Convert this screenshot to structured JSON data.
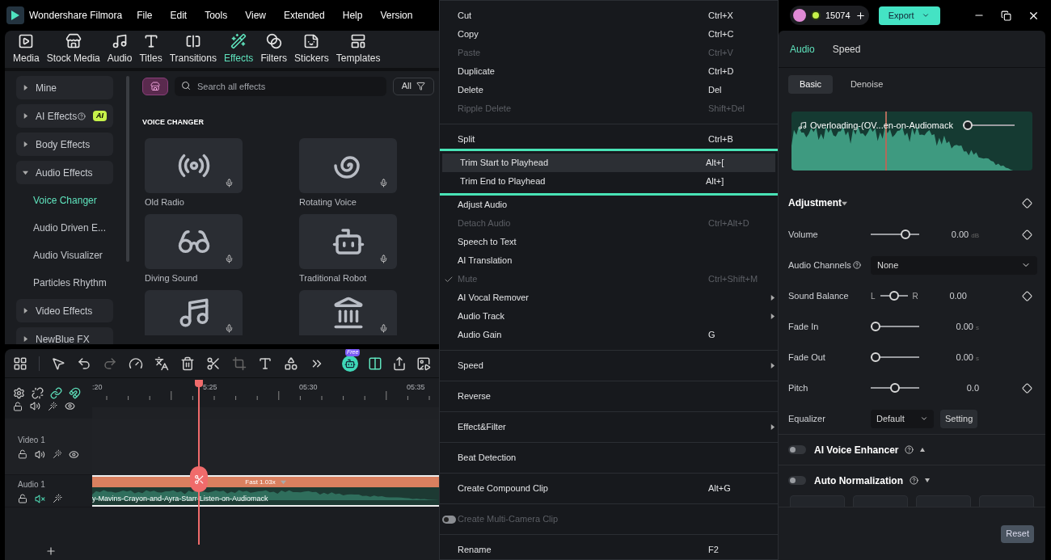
{
  "app": {
    "title": "Wondershare Filmora"
  },
  "menu_bar": [
    "File",
    "Edit",
    "Tools",
    "View",
    "Extended",
    "Help",
    "Version"
  ],
  "media_tabs": [
    {
      "label": "Media",
      "selected": false
    },
    {
      "label": "Stock Media",
      "selected": false
    },
    {
      "label": "Audio",
      "selected": false
    },
    {
      "label": "Titles",
      "selected": false
    },
    {
      "label": "Transitions",
      "selected": false
    },
    {
      "label": "Effects",
      "selected": true
    },
    {
      "label": "Filters",
      "selected": false
    },
    {
      "label": "Stickers",
      "selected": false
    },
    {
      "label": "Templates",
      "selected": false
    }
  ],
  "sidebar": {
    "items": [
      {
        "label": "Mine",
        "expanded": false
      },
      {
        "label": "AI Effects",
        "help": true,
        "badge": "AI",
        "expanded": false
      },
      {
        "label": "Body Effects",
        "expanded": false
      },
      {
        "label": "Audio Effects",
        "expanded": true,
        "children": [
          {
            "label": "Voice Changer",
            "selected": true
          },
          {
            "label": "Audio Driven E...",
            "selected": false
          },
          {
            "label": "Audio Visualizer",
            "selected": false
          },
          {
            "label": "Particles Rhythm",
            "selected": false
          }
        ]
      },
      {
        "label": "Video Effects",
        "expanded": false
      },
      {
        "label": "NewBlue FX",
        "expanded": false
      }
    ]
  },
  "effects": {
    "search": {
      "placeholder": "Search all effects"
    },
    "filter": "All",
    "section": "VOICE CHANGER",
    "items": [
      {
        "kind": "tile",
        "name": "Old Radio"
      },
      {
        "kind": "tile",
        "name": "Rotating Voice"
      },
      {
        "kind": "tile",
        "name": "Diving Sound"
      },
      {
        "kind": "tile",
        "name": "Traditional Robot"
      },
      {
        "kind": "partial"
      },
      {
        "kind": "partial"
      }
    ]
  },
  "timeline": {
    "free_badge": "Free",
    "ruler": [
      ":20",
      "5:25",
      "05:30",
      "05:35"
    ],
    "tracks": [
      {
        "kind": "partial",
        "muted": false
      },
      {
        "kind": "video",
        "name": "Video 1",
        "muted": false
      },
      {
        "kind": "audio",
        "name": "Audio 1",
        "muted": true
      }
    ],
    "clip": {
      "speed": "Fast 1.03x",
      "name": "y-Mavins-Crayon-and-Ayra-Starr-Listen-on-Audiomack"
    }
  },
  "context_menu": {
    "sections": [
      {
        "divider": false,
        "outlined": false,
        "items": [
          {
            "kind": "plain",
            "label": "Cut",
            "shortcut": "Ctrl+X",
            "disabled": false,
            "checked": false,
            "submenu": false,
            "hovered": false
          },
          {
            "kind": "plain",
            "label": "Copy",
            "shortcut": "Ctrl+C",
            "disabled": false,
            "checked": false,
            "submenu": false,
            "hovered": false
          },
          {
            "kind": "plain",
            "label": "Paste",
            "shortcut": "Ctrl+V",
            "disabled": true,
            "checked": false,
            "submenu": false,
            "hovered": false
          },
          {
            "kind": "plain",
            "label": "Duplicate",
            "shortcut": "Ctrl+D",
            "disabled": false,
            "checked": false,
            "submenu": false,
            "hovered": false
          },
          {
            "kind": "plain",
            "label": "Delete",
            "shortcut": "Del",
            "disabled": false,
            "checked": false,
            "submenu": false,
            "hovered": false
          },
          {
            "kind": "plain",
            "label": "Ripple Delete",
            "shortcut": "Shift+Del",
            "disabled": true,
            "checked": false,
            "submenu": false,
            "hovered": false
          }
        ]
      },
      {
        "divider": true,
        "outlined": false,
        "items": [
          {
            "kind": "plain",
            "label": "Split",
            "shortcut": "Ctrl+B",
            "disabled": false,
            "checked": false,
            "submenu": false,
            "hovered": false
          }
        ]
      },
      {
        "divider": false,
        "outlined": true,
        "items": [
          {
            "kind": "plain",
            "label": "Trim Start to Playhead",
            "shortcut": "Alt+[",
            "disabled": false,
            "checked": false,
            "submenu": false,
            "hovered": true
          },
          {
            "kind": "plain",
            "label": "Trim End to Playhead",
            "shortcut": "Alt+]",
            "disabled": false,
            "checked": false,
            "submenu": false,
            "hovered": false
          }
        ]
      },
      {
        "divider": false,
        "outlined": false,
        "items": [
          {
            "kind": "plain",
            "label": "Adjust Audio",
            "disabled": false,
            "checked": false,
            "submenu": false,
            "hovered": false
          },
          {
            "kind": "plain",
            "label": "Detach Audio",
            "shortcut": "Ctrl+Alt+D",
            "disabled": true,
            "checked": false,
            "submenu": false,
            "hovered": false
          },
          {
            "kind": "plain",
            "label": "Speech to Text",
            "disabled": false,
            "checked": false,
            "submenu": false,
            "hovered": false
          },
          {
            "kind": "plain",
            "label": "AI Translation",
            "disabled": false,
            "checked": false,
            "submenu": false,
            "hovered": false
          },
          {
            "kind": "check",
            "label": "Mute",
            "shortcut": "Ctrl+Shift+M",
            "disabled": true,
            "checked": true,
            "submenu": false,
            "hovered": false
          },
          {
            "kind": "plain",
            "label": "AI Vocal Remover",
            "disabled": false,
            "checked": false,
            "submenu": true,
            "hovered": false
          },
          {
            "kind": "plain",
            "label": "Audio Track",
            "disabled": false,
            "checked": false,
            "submenu": true,
            "hovered": false
          },
          {
            "kind": "plain",
            "label": "Audio Gain",
            "shortcut": "G",
            "disabled": false,
            "checked": false,
            "submenu": false,
            "hovered": false
          }
        ]
      },
      {
        "divider": true,
        "outlined": false,
        "items": [
          {
            "kind": "plain",
            "label": "Speed",
            "disabled": false,
            "checked": false,
            "submenu": true,
            "hovered": false
          }
        ]
      },
      {
        "divider": true,
        "outlined": false,
        "items": [
          {
            "kind": "plain",
            "label": "Reverse",
            "disabled": false,
            "checked": false,
            "submenu": false,
            "hovered": false
          }
        ]
      },
      {
        "divider": true,
        "outlined": false,
        "items": [
          {
            "kind": "plain",
            "label": "Effect&Filter",
            "disabled": false,
            "checked": false,
            "submenu": true,
            "hovered": false
          }
        ]
      },
      {
        "divider": true,
        "outlined": false,
        "items": [
          {
            "kind": "plain",
            "label": "Beat Detection",
            "disabled": false,
            "checked": false,
            "submenu": false,
            "hovered": false
          }
        ]
      },
      {
        "divider": true,
        "outlined": false,
        "items": [
          {
            "kind": "plain",
            "label": "Create Compound Clip",
            "shortcut": "Alt+G",
            "disabled": false,
            "checked": false,
            "submenu": false,
            "hovered": false
          }
        ]
      },
      {
        "divider": true,
        "outlined": false,
        "items": [
          {
            "kind": "switch",
            "label": "Create Multi-Camera Clip",
            "disabled": true,
            "checked": false,
            "submenu": false,
            "hovered": false
          }
        ]
      },
      {
        "divider": true,
        "outlined": false,
        "items": [
          {
            "kind": "plain",
            "label": "Rename",
            "shortcut": "F2",
            "disabled": false,
            "checked": false,
            "submenu": false,
            "hovered": false
          }
        ]
      }
    ]
  },
  "account": {
    "credits": "15074",
    "export": "Export"
  },
  "properties": {
    "tabs": [
      {
        "label": "Audio",
        "selected": true
      },
      {
        "label": "Speed",
        "selected": false
      }
    ],
    "subtabs": [
      {
        "label": "Basic",
        "selected": true
      },
      {
        "label": "Denoise",
        "selected": false
      }
    ],
    "clip": {
      "name": "Overloading-(OV...en-on-Audiomack",
      "level": 0
    },
    "section": "Adjustment",
    "rows": [
      {
        "kind": "slider",
        "label": "Volume",
        "level": 0.77,
        "value": "0.00",
        "unit": "dB",
        "keyframe": true
      },
      {
        "kind": "dropdown",
        "label": "Audio Channels",
        "help": true,
        "value": "None"
      },
      {
        "kind": "balance",
        "label": "Sound Balance",
        "left": "L",
        "right": "R",
        "level": 0.5,
        "value": "0.00",
        "keyframe": true
      },
      {
        "kind": "slider",
        "label": "Fade In",
        "level": 0,
        "value": "0.00",
        "unit": "s"
      },
      {
        "kind": "slider",
        "label": "Fade Out",
        "level": 0,
        "value": "0.00",
        "unit": "s"
      },
      {
        "kind": "slider",
        "label": "Pitch",
        "level": 0.5,
        "value": "0.0",
        "keyframe": true
      },
      {
        "kind": "equalizer",
        "label": "Equalizer",
        "value": "Default",
        "button": "Setting"
      }
    ],
    "toggles": [
      {
        "label": "AI Voice Enhancer",
        "on": false,
        "expanded": true
      },
      {
        "label": "Auto Normalization",
        "on": false,
        "expanded": false
      }
    ],
    "reset": "Reset"
  }
}
